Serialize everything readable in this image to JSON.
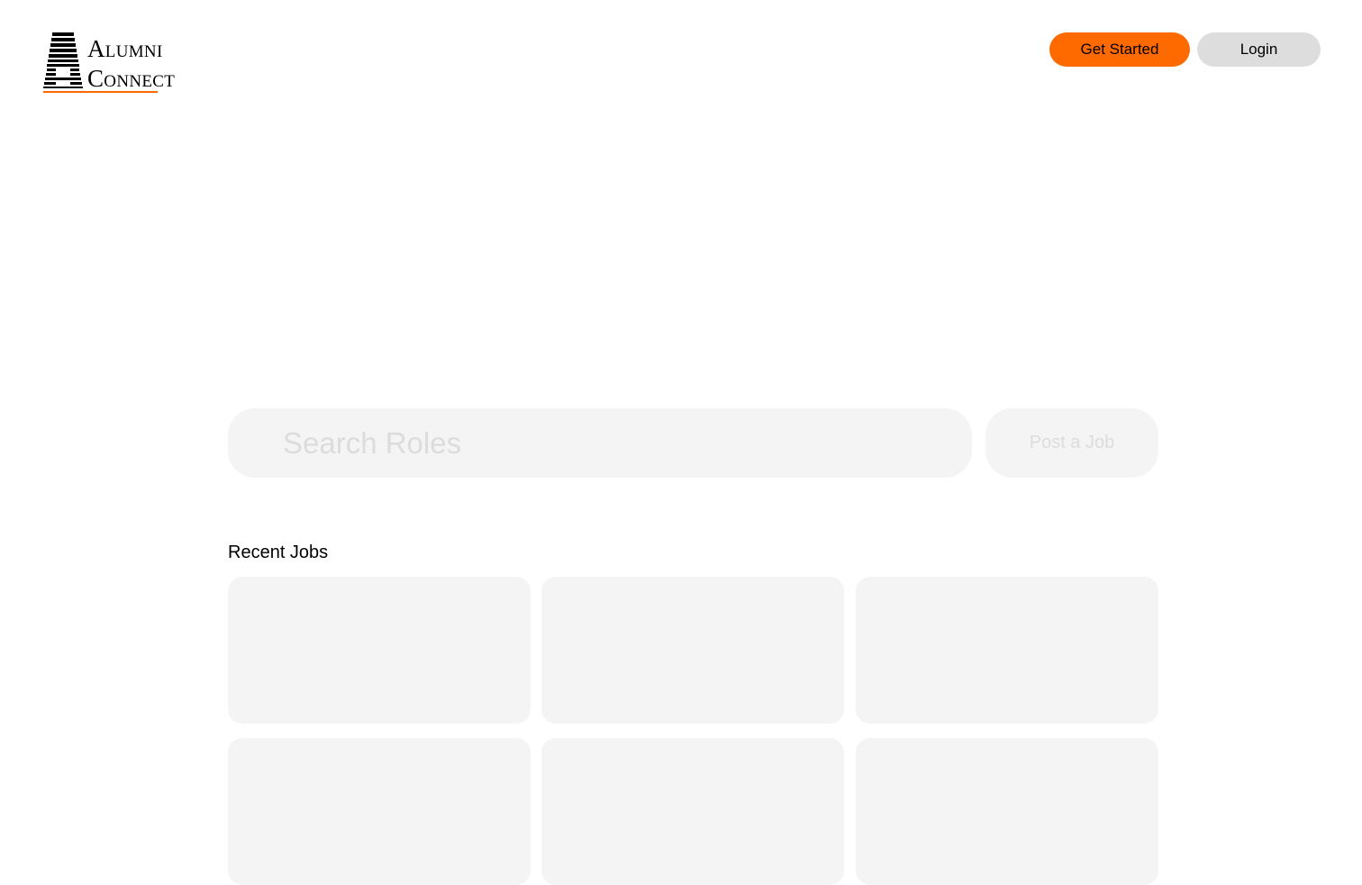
{
  "logo": {
    "line1": "Alumni",
    "line2": "Connect",
    "accent_color": "#ff6a00"
  },
  "header": {
    "get_started_label": "Get Started",
    "login_label": "Login",
    "primary_color": "#ff6a00",
    "secondary_color": "#dddddd"
  },
  "search": {
    "placeholder": "Search Roles",
    "value": "",
    "post_job_label": "Post a Job"
  },
  "recent_jobs": {
    "title": "Recent Jobs",
    "cards": [
      {},
      {},
      {},
      {},
      {},
      {}
    ]
  }
}
